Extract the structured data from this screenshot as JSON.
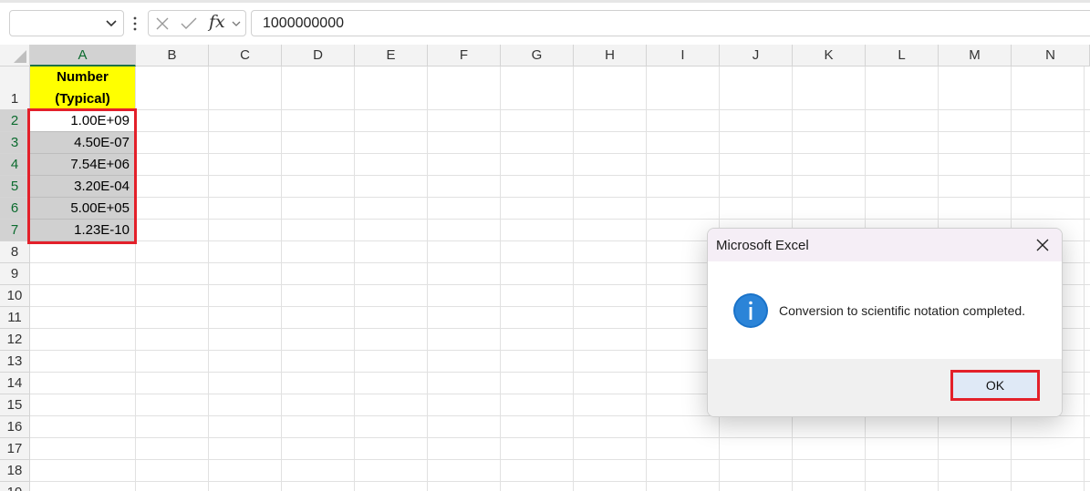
{
  "formula_bar": {
    "name_box_value": "",
    "fx_label": "fx",
    "formula_value": "1000000000"
  },
  "columns": [
    "A",
    "B",
    "C",
    "D",
    "E",
    "F",
    "G",
    "H",
    "I",
    "J",
    "K",
    "L",
    "M",
    "N"
  ],
  "rows": [
    "1",
    "2",
    "3",
    "4",
    "5",
    "6",
    "7",
    "8",
    "9",
    "10",
    "11",
    "12",
    "13",
    "14",
    "15",
    "16",
    "17",
    "18",
    "19"
  ],
  "sheet": {
    "header_line1": "Number",
    "header_line2": "(Typical)",
    "values": [
      "1.00E+09",
      "4.50E-07",
      "7.54E+06",
      "3.20E-04",
      "5.00E+05",
      "1.23E-10"
    ]
  },
  "dialog": {
    "title": "Microsoft Excel",
    "message": "Conversion to scientific notation completed.",
    "ok_label": "OK"
  },
  "colors": {
    "header_fill": "#ffff00",
    "selection_fill": "#d0d0d0",
    "highlight_border": "#e3202a",
    "info_icon": "#1a73c9"
  },
  "icons": [
    "chevron-down-icon",
    "more-vertical-icon",
    "cancel-x-icon",
    "check-icon",
    "fx-icon",
    "info-icon",
    "close-icon"
  ]
}
